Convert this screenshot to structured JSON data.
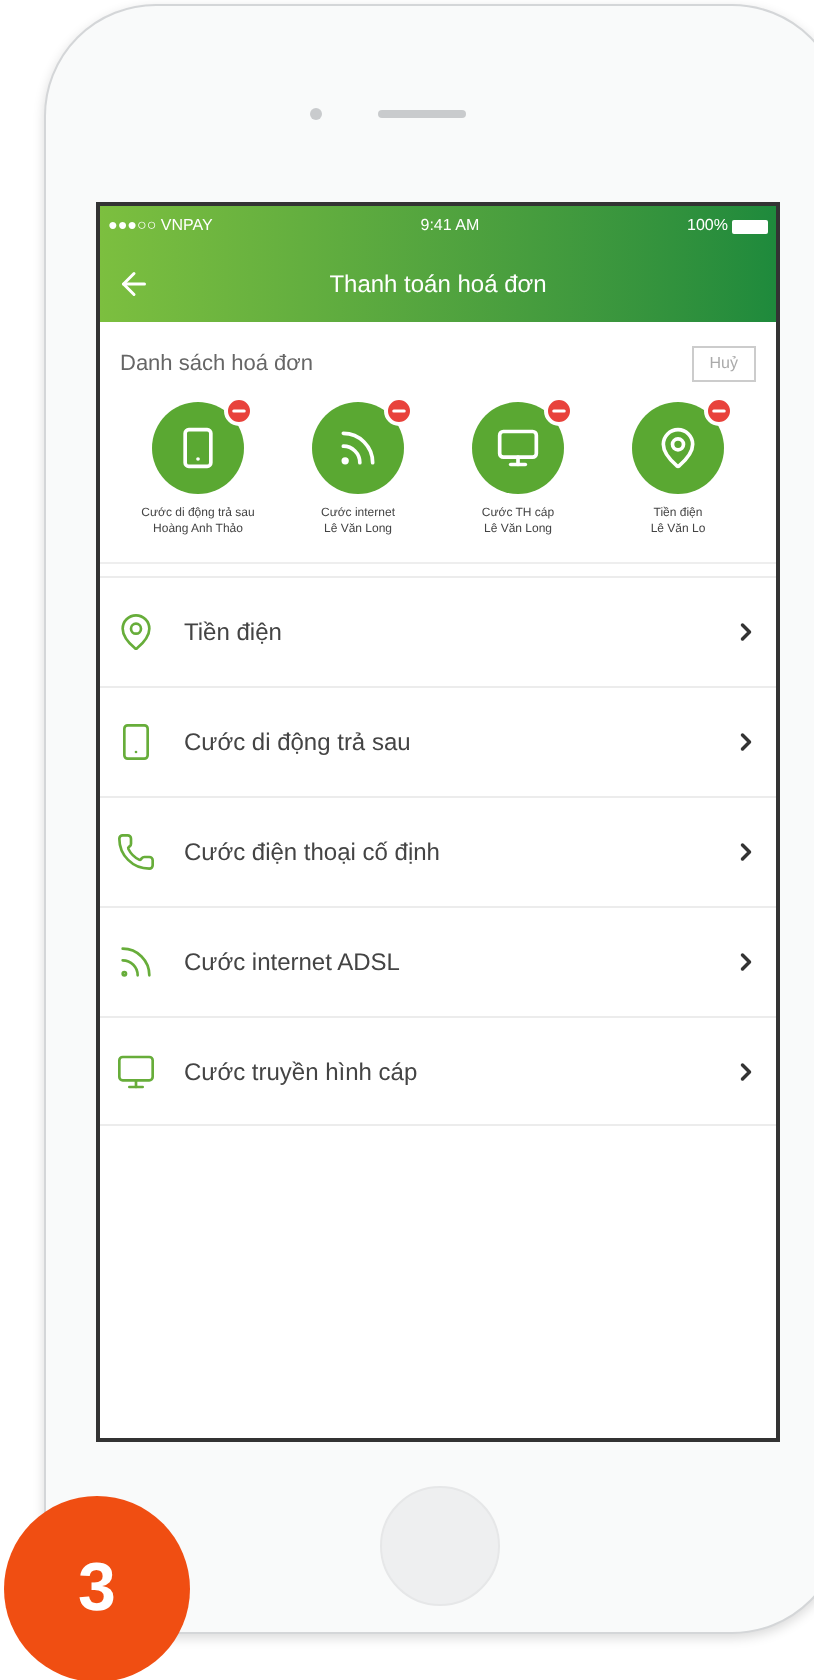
{
  "status_bar": {
    "carrier": "●●●○○ VNPAY",
    "time": "9:41 AM",
    "battery": "100%"
  },
  "header": {
    "title": "Thanh toán hoá đơn"
  },
  "saved_bills": {
    "title": "Danh sách hoá đơn",
    "action": "Huỷ",
    "items": [
      {
        "kind": "mobile",
        "name": "Cước di động trả sau",
        "owner": "Hoàng Anh Thảo"
      },
      {
        "kind": "internet",
        "name": "Cước internet",
        "owner": "Lê Văn Long"
      },
      {
        "kind": "tv",
        "name": "Cước TH cáp",
        "owner": "Lê Văn Long"
      },
      {
        "kind": "electricity",
        "name": "Tiền điện",
        "owner": "Lê Văn Lo"
      }
    ]
  },
  "services": [
    {
      "kind": "electricity",
      "label": "Tiền điện"
    },
    {
      "kind": "mobile",
      "label": "Cước di động trả sau"
    },
    {
      "kind": "phone",
      "label": "Cước điện thoại cố định"
    },
    {
      "kind": "internet",
      "label": "Cước internet ADSL"
    },
    {
      "kind": "tv",
      "label": "Cước truyền hình cáp"
    }
  ],
  "step_badge": "3"
}
